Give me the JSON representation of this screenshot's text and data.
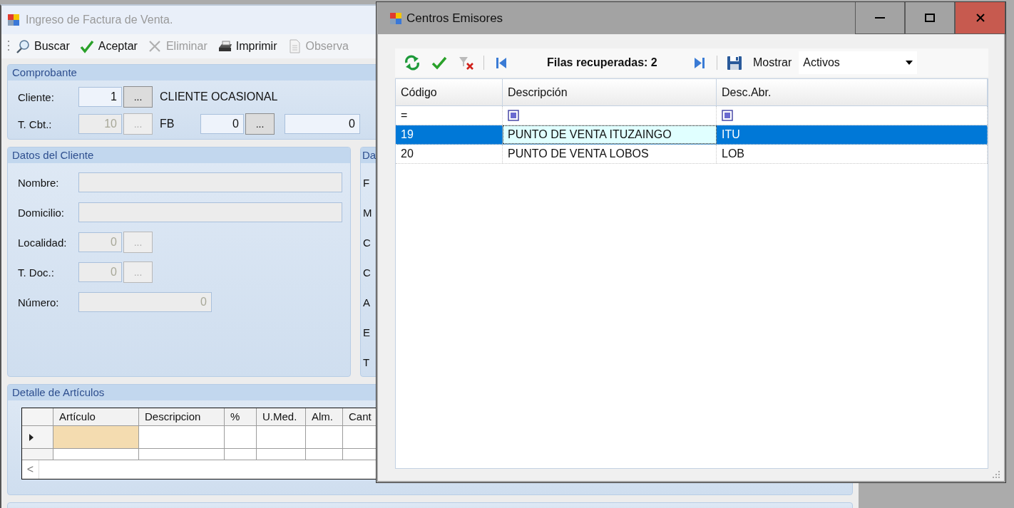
{
  "main_window": {
    "title": "Ingreso de Factura de Venta.",
    "toolbar": [
      {
        "kind": "search",
        "label": "Buscar",
        "disabled": false
      },
      {
        "kind": "accept",
        "label": "Aceptar",
        "disabled": false
      },
      {
        "kind": "delete",
        "label": "Eliminar",
        "disabled": true
      },
      {
        "kind": "print",
        "label": "Imprimir",
        "disabled": false
      },
      {
        "kind": "notes",
        "label": "Observa",
        "disabled": true
      }
    ],
    "comprobante": {
      "title": "Comprobante",
      "rows": [
        {
          "label": "Cliente:",
          "items": [
            {
              "kind": "code_field",
              "value": "1",
              "disabled": false
            },
            {
              "kind": "lookup",
              "label": "...",
              "disabled": false
            },
            {
              "kind": "text",
              "text": "CLIENTE OCASIONAL"
            }
          ]
        },
        {
          "label": "T. Cbt.:",
          "items": [
            {
              "kind": "code_field",
              "value": "10",
              "disabled": true
            },
            {
              "kind": "lookup",
              "label": "...",
              "disabled": true
            },
            {
              "kind": "text",
              "text": "FB"
            },
            {
              "kind": "code_field",
              "value": "0",
              "disabled": false
            },
            {
              "kind": "lookup",
              "label": "...",
              "disabled": false
            },
            {
              "kind": "amount_field",
              "value": "0",
              "disabled": false
            }
          ]
        }
      ]
    },
    "datos_cliente": {
      "title": "Datos del Cliente",
      "rows": [
        {
          "label": "Nombre:",
          "items": [
            {
              "kind": "text_field",
              "disabled": true
            }
          ]
        },
        {
          "label": "Domicilio:",
          "items": [
            {
              "kind": "text_field",
              "disabled": true
            }
          ]
        },
        {
          "label": "Localidad:",
          "items": [
            {
              "kind": "code_field",
              "value": "0",
              "disabled": true
            },
            {
              "kind": "lookup",
              "label": "...",
              "disabled": true
            }
          ]
        },
        {
          "label": "T. Doc.:",
          "items": [
            {
              "kind": "code_field",
              "value": "0",
              "disabled": true
            },
            {
              "kind": "lookup",
              "label": "...",
              "disabled": true
            }
          ]
        },
        {
          "label": "Número:",
          "items": [
            {
              "kind": "number_field",
              "value": "0",
              "disabled": true
            }
          ]
        }
      ]
    },
    "group_2": {
      "title": "Da",
      "labels": [
        "F",
        "M",
        "C",
        "C",
        "A",
        "E",
        "T"
      ]
    },
    "detalle": {
      "title": "Detalle de Artículos",
      "columns": [
        "Artículo",
        "Descripcion",
        "%",
        "U.Med.",
        "Alm.",
        "Cant"
      ],
      "rows": [
        {
          "current": true
        },
        {
          "current": false
        }
      ],
      "scroll_left": "<"
    }
  },
  "dialog": {
    "title": "Centros Emisores",
    "toolbar": {
      "status": "Filas recuperadas: 2",
      "show_label": "Mostrar",
      "show_value": "Activos"
    },
    "columns": [
      "Código",
      "Descripción",
      "Desc.Abr."
    ],
    "filter": [
      {
        "kind": "operator",
        "text": "="
      },
      {
        "kind": "icon"
      },
      {
        "kind": "icon"
      }
    ],
    "rows": [
      {
        "selected": true,
        "cells": [
          {
            "text": "19",
            "focused": false
          },
          {
            "text": "PUNTO DE VENTA ITUZAINGO",
            "focused": true
          },
          {
            "text": "ITU",
            "focused": false
          }
        ]
      },
      {
        "selected": false,
        "cells": [
          {
            "text": "20",
            "focused": false
          },
          {
            "text": "PUNTO DE VENTA LOBOS",
            "focused": false
          },
          {
            "text": "LOB",
            "focused": false
          }
        ]
      }
    ]
  }
}
